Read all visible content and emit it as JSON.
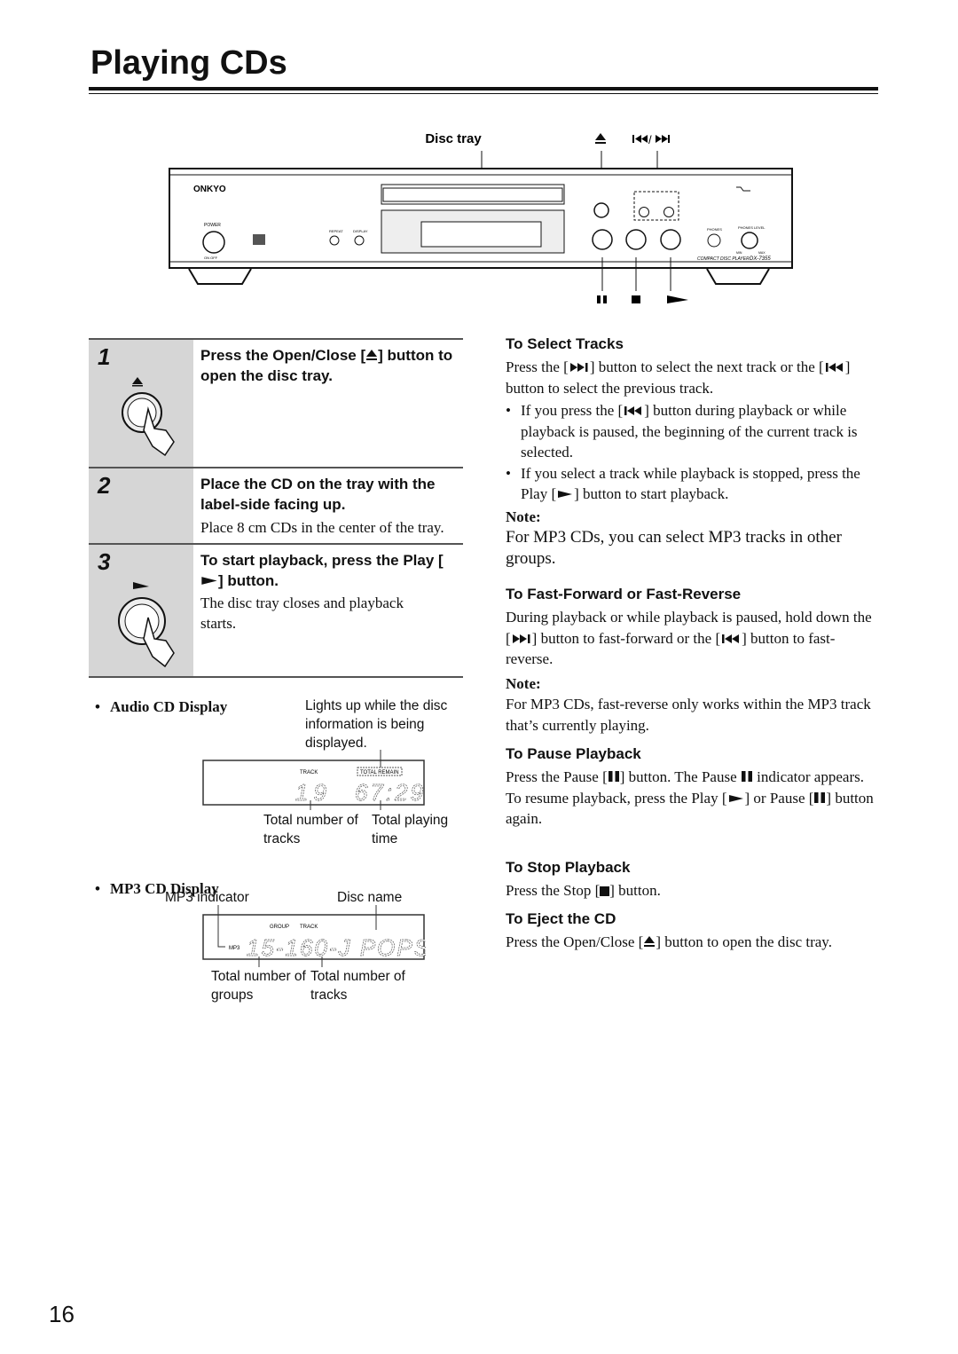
{
  "title": "Playing CDs",
  "diagram": {
    "disc_tray": "Disc tray",
    "brand": "ONKYO",
    "power": "POWER",
    "on_off": "ON  OFF",
    "repeat": "REPEAT",
    "display": "DISPLAY",
    "phones": "PHONES",
    "phones_level": "PHONES LEVEL",
    "min": "MIN",
    "max": "MAX",
    "model_line": "COMPACT DISC PLAYER",
    "model": "DX-7355"
  },
  "steps": [
    {
      "num": "1",
      "head": "Press the Open/Close [",
      "head_b": "] button to open the disc tray.",
      "body": ""
    },
    {
      "num": "2",
      "head": "Place the CD on the tray with the label-side facing up.",
      "body": "Place 8 cm CDs in the center of the tray."
    },
    {
      "num": "3",
      "head": "To start playback, press the Play [",
      "head_b": "] button.",
      "body": "The disc tray closes and playback starts."
    }
  ],
  "audio_display": {
    "title": "Audio CD Display",
    "desc": "Lights up while the disc information is being displayed.",
    "track_label": "TRACK",
    "total_remain": "TOTAL REMAIN",
    "digits_tracks": "19",
    "digits_time": "67:29",
    "caption_tracks": "Total number of tracks",
    "caption_time": "Total playing time"
  },
  "mp3_display": {
    "title": "MP3 CD Display",
    "mp3_indicator": "MP3 indicator",
    "disc_name": "Disc name",
    "group_label": "GROUP",
    "track_label": "TRACK",
    "mp3": "MP3",
    "digits": "15-160-J POPS",
    "caption_groups": "Total number of groups",
    "caption_tracks": "Total number of tracks"
  },
  "right": {
    "select": {
      "title": "To Select Tracks",
      "p1a": "Press the [",
      "p1b": "] button to select the next track or the [",
      "p1c": "] button to select the previous track.",
      "b1a": "If you press the [",
      "b1b": "] button during playback or while playback is paused, the beginning of the current track is selected.",
      "b2a": "If you select a track while playback is stopped, press the Play [",
      "b2b": "] button to start playback.",
      "note": "Note:",
      "note_text": "For MP3 CDs, you can select MP3 tracks in other groups."
    },
    "ff": {
      "title": "To Fast-Forward or Fast-Reverse",
      "p1a": "During playback or while playback is paused, hold down the [",
      "p1b": "] button to fast-forward or the [",
      "p1c": "] button to fast-reverse.",
      "note": "Note:",
      "note_text": "For MP3 CDs, fast-reverse only works within the MP3 track that’s currently playing."
    },
    "pause": {
      "title": "To Pause Playback",
      "p1a": "Press the Pause [",
      "p1b": "] button. The Pause ",
      "p1c": " indicator appears.",
      "p2a": "To resume playback, press the Play [",
      "p2b": "] or Pause [",
      "p2c": "] button again."
    },
    "stop": {
      "title": "To Stop Playback",
      "p1a": "Press the Stop [",
      "p1b": "] button."
    },
    "eject": {
      "title": "To Eject the CD",
      "p1a": "Press the Open/Close [",
      "p1b": "] button to open the disc tray."
    }
  },
  "page_number": "16"
}
